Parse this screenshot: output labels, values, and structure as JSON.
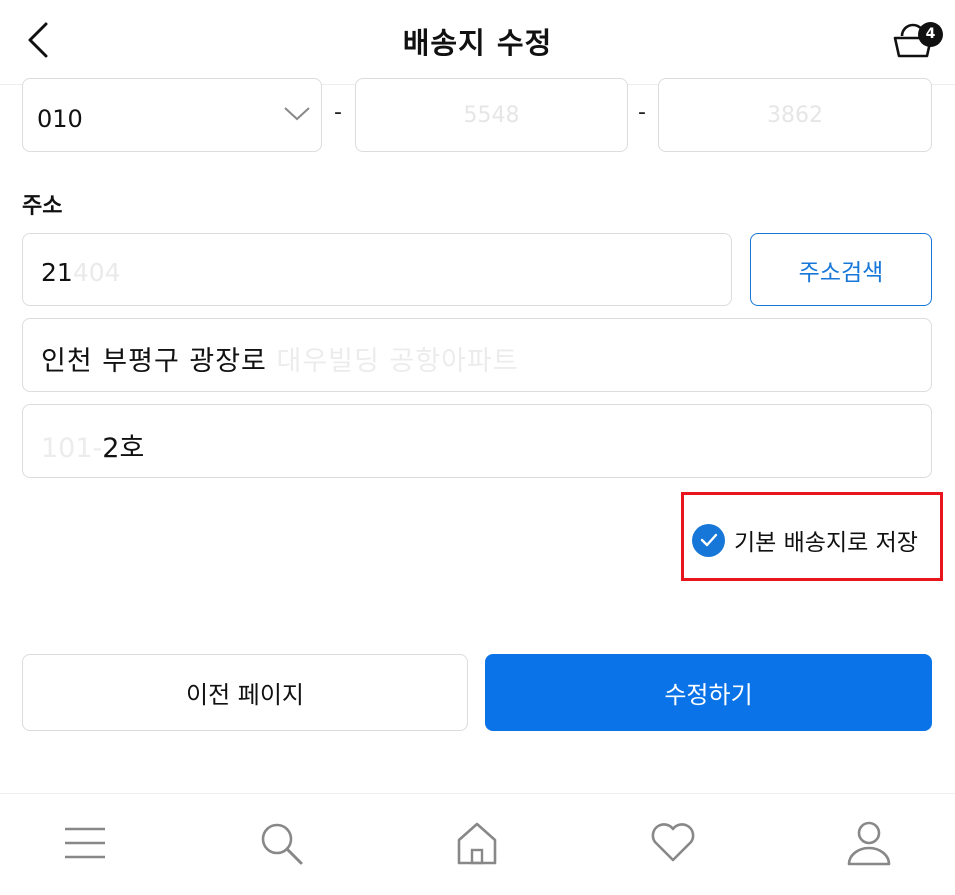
{
  "header": {
    "title": "배송지 수정",
    "cart_count": "4"
  },
  "phone": {
    "prefix": "010",
    "middle": "5548",
    "last": "3862",
    "separator": "-"
  },
  "address": {
    "label": "주소",
    "zip_visible": "21",
    "zip_obscured": "404",
    "search_button": "주소검색",
    "line1_visible": "인천 부평구 광장로",
    "line1_obscured": " 대우빌딩 공항아파트",
    "line2_obscured": "101-",
    "line2_visible": "2호"
  },
  "default_option": {
    "label": "기본 배송지로 저장",
    "checked": true
  },
  "buttons": {
    "prev": "이전 페이지",
    "submit": "수정하기"
  },
  "colors": {
    "accent": "#0a73e8",
    "highlight": "#e8161c"
  },
  "nav": {
    "icons": [
      "menu-icon",
      "search-icon",
      "home-icon",
      "heart-icon",
      "user-icon"
    ]
  }
}
